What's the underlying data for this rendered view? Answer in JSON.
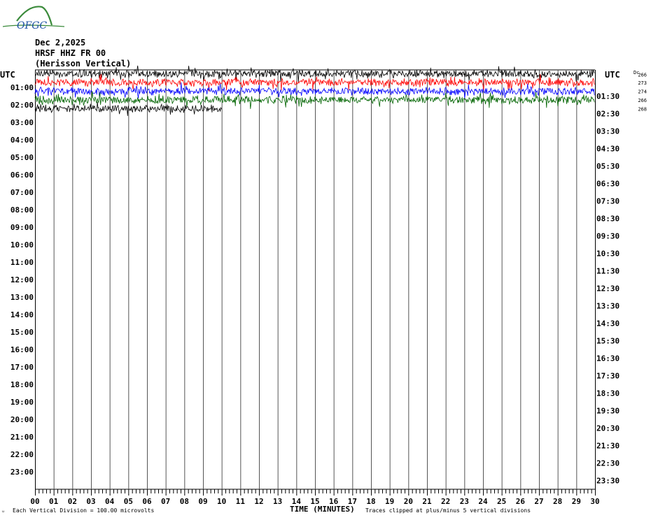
{
  "logo": {
    "text": "OFGC",
    "colors": {
      "text": "#1a4fa3",
      "arc": "#3a8a3a"
    }
  },
  "header": {
    "date": "Dec 2,2025",
    "station": "HRSF HHZ FR 00",
    "location": "(Herisson Vertical)"
  },
  "chart_data": {
    "type": "line",
    "xlabel": "TIME (MINUTES)",
    "x_ticks": [
      "00",
      "01",
      "02",
      "03",
      "04",
      "05",
      "06",
      "07",
      "08",
      "09",
      "10",
      "11",
      "12",
      "13",
      "14",
      "15",
      "16",
      "17",
      "18",
      "19",
      "20",
      "21",
      "22",
      "23",
      "24",
      "25",
      "26",
      "27",
      "28",
      "29",
      "30"
    ],
    "xlim": [
      0,
      30
    ],
    "left_axis_title": "UTC",
    "right_axis_title": "UTC",
    "left_labels": [
      "01:00",
      "02:00",
      "03:00",
      "04:00",
      "05:00",
      "06:00",
      "07:00",
      "08:00",
      "09:00",
      "10:00",
      "11:00",
      "12:00",
      "13:00",
      "14:00",
      "15:00",
      "16:00",
      "17:00",
      "18:00",
      "19:00",
      "20:00",
      "21:00",
      "22:00",
      "23:00"
    ],
    "right_labels": [
      "01:30",
      "02:30",
      "03:30",
      "04:30",
      "05:30",
      "06:30",
      "07:30",
      "08:30",
      "09:30",
      "10:30",
      "11:30",
      "12:30",
      "13:30",
      "14:30",
      "15:30",
      "16:30",
      "17:30",
      "18:30",
      "19:30",
      "20:30",
      "21:30",
      "22:30",
      "23:30"
    ],
    "dc_header": "Dc",
    "rows": 48,
    "traces": [
      {
        "row": 0,
        "dc": "266",
        "color": "#000000",
        "end_minute": 30
      },
      {
        "row": 1,
        "dc": "273",
        "color": "#ff0000",
        "end_minute": 30
      },
      {
        "row": 2,
        "dc": "274",
        "color": "#0000ff",
        "end_minute": 30
      },
      {
        "row": 3,
        "dc": "266",
        "color": "#006400",
        "end_minute": 30
      },
      {
        "row": 4,
        "dc": "268",
        "color": "#000000",
        "end_minute": 10
      }
    ],
    "grid": true
  },
  "footer": {
    "vertical_division": "Each Vertical Division =  100.00 microvolts",
    "clip_note": "Traces clipped at plus/minus 5 vertical divisions"
  }
}
